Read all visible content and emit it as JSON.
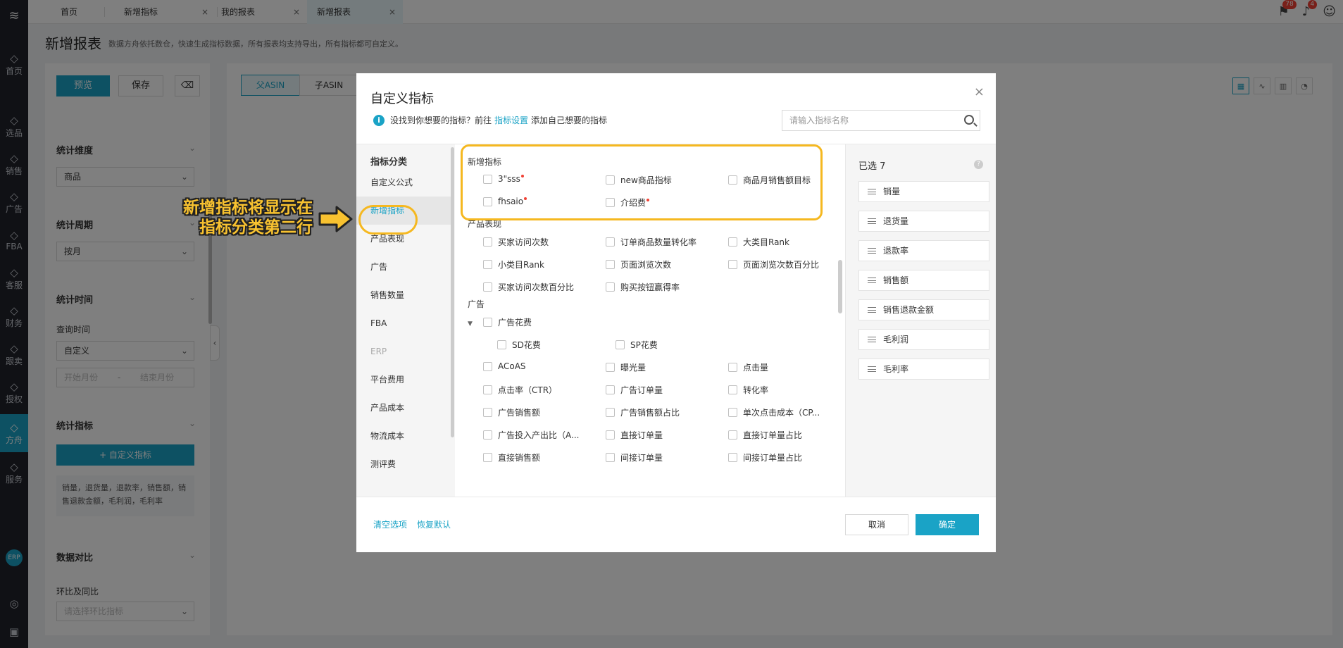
{
  "tabs": [
    {
      "label": "首页",
      "closable": false,
      "active": false
    },
    {
      "label": "新增指标",
      "closable": true,
      "active": false
    },
    {
      "label": "我的报表",
      "closable": true,
      "active": false
    },
    {
      "label": "新增报表",
      "closable": true,
      "active": true
    }
  ],
  "tab_close_glyph": "×",
  "notifications": {
    "flag_count": "78",
    "bell_count": "4"
  },
  "leftnav": [
    {
      "label": "首页",
      "icon": "home-icon"
    },
    {
      "label": "选品",
      "icon": "search-icon"
    },
    {
      "label": "销售",
      "icon": "chart-icon"
    },
    {
      "label": "广告",
      "icon": "ad-icon"
    },
    {
      "label": "FBA",
      "icon": "fba-icon"
    },
    {
      "label": "客服",
      "icon": "service-icon"
    },
    {
      "label": "财务",
      "icon": "finance-icon"
    },
    {
      "label": "跟卖",
      "icon": "follow-icon"
    },
    {
      "label": "授权",
      "icon": "shield-icon"
    },
    {
      "label": "方舟",
      "icon": "ark-icon",
      "active": true
    },
    {
      "label": "服务",
      "icon": "service2-icon"
    }
  ],
  "nav_erp": "ERP",
  "page": {
    "title": "新增报表",
    "desc": "数据方舟依托数仓，快速生成指标数据，所有报表均支持导出，所有指标都可自定义。"
  },
  "left_panel": {
    "preview_btn": "预览",
    "save_btn": "保存",
    "sections": {
      "dimension": "统计维度",
      "period": "统计周期",
      "time": "统计时间",
      "metrics": "统计指标",
      "compare": "数据对比"
    },
    "dimension_value": "商品",
    "period_value": "按月",
    "query_time_label": "查询时间",
    "query_time_value": "自定义",
    "start_month_placeholder": "开始月份",
    "date_sep": "-",
    "end_month_placeholder": "结束月份",
    "custom_metric_btn": "+ 自定义指标",
    "metrics_summary": "销量，退货量，退款率，销售额，销售退款金额，毛利润，毛利率",
    "compare_label": "环比及同比",
    "compare_placeholder": "请选择环比指标"
  },
  "right_panel": {
    "segments": [
      "父ASIN",
      "子ASIN"
    ],
    "active_segment": 0
  },
  "modal": {
    "title": "自定义指标",
    "info_prefix": "没找到你想要的指标？前往",
    "info_link": "指标设置",
    "info_suffix": "添加自己想要的指标",
    "search_placeholder": "请输入指标名称",
    "category_header": "指标分类",
    "categories": [
      {
        "label": "自定义公式",
        "state": "normal"
      },
      {
        "label": "新增指标",
        "state": "active"
      },
      {
        "label": "产品表现",
        "state": "normal"
      },
      {
        "label": "广告",
        "state": "normal"
      },
      {
        "label": "销售数量",
        "state": "normal"
      },
      {
        "label": "FBA",
        "state": "normal"
      },
      {
        "label": "ERP",
        "state": "disabled"
      },
      {
        "label": "平台费用",
        "state": "normal"
      },
      {
        "label": "产品成本",
        "state": "normal"
      },
      {
        "label": "物流成本",
        "state": "normal"
      },
      {
        "label": "测评费",
        "state": "normal"
      }
    ],
    "groups": {
      "new": {
        "title": "新增指标",
        "items": [
          "3\"sss",
          "new商品指标",
          "商品月销售额目标",
          "fhsaio",
          "介绍费"
        ],
        "new_badge": [
          true,
          false,
          false,
          true,
          true
        ]
      },
      "product": {
        "title": "产品表现",
        "items": [
          "买家访问次数",
          "订单商品数量转化率",
          "大类目Rank",
          "小类目Rank",
          "页面浏览次数",
          "页面浏览次数百分比",
          "买家访问次数百分比",
          "购买按钮赢得率"
        ]
      },
      "ads": {
        "title": "广告",
        "parent": "广告花费",
        "children": [
          "SD花费",
          "SP花费"
        ],
        "items": [
          "ACoAS",
          "曝光量",
          "点击量",
          "点击率（CTR）",
          "广告订单量",
          "转化率",
          "广告销售额",
          "广告销售额占比",
          "单次点击成本（CP...",
          "广告投入产出比（A...",
          "直接订单量",
          "直接订单量占比",
          "直接销售额",
          "间接订单量",
          "间接订单量占比"
        ]
      }
    },
    "selected_header": "已选 7",
    "selected": [
      "销量",
      "退货量",
      "退款率",
      "销售额",
      "销售退款金额",
      "毛利润",
      "毛利率"
    ],
    "clear_link": "清空选项",
    "restore_link": "恢复默认",
    "cancel_btn": "取消",
    "ok_btn": "确定",
    "close_glyph": "×"
  },
  "annotation": {
    "line1": "新增指标将显示在",
    "line2": "指标分类第二行",
    "color": "#f5b820"
  },
  "colors": {
    "primary": "#1aa3c6",
    "nav_bg": "#20222a",
    "badge": "#f04134"
  }
}
